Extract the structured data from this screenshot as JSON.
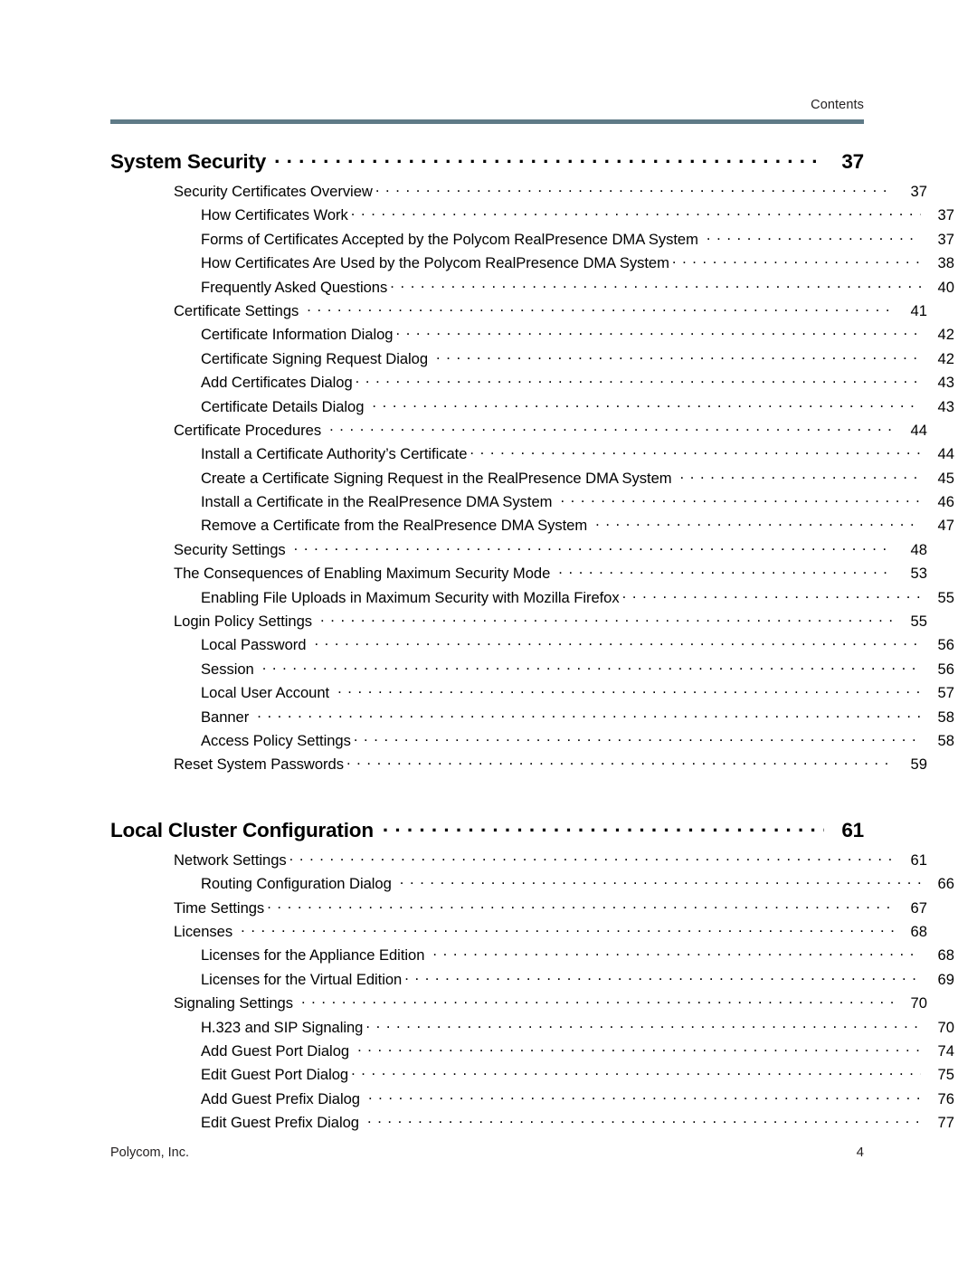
{
  "header": {
    "running_head": "Contents",
    "rule_color": "#5f7a87"
  },
  "footer": {
    "company": "Polycom, Inc.",
    "page_number": "4"
  },
  "toc": {
    "entries": [
      {
        "level": 0,
        "label": "System Security",
        "page": "37",
        "gap_before": false,
        "wide_leader_gap": true
      },
      {
        "level": 1,
        "label": "Security Certificates Overview",
        "page": "37",
        "gap_before": false,
        "wide_leader_gap": false
      },
      {
        "level": 2,
        "label": "How Certificates Work",
        "page": "37",
        "gap_before": false,
        "wide_leader_gap": false
      },
      {
        "level": 2,
        "label": "Forms of Certificates Accepted by the Polycom RealPresence DMA System",
        "page": "37",
        "gap_before": false,
        "wide_leader_gap": true
      },
      {
        "level": 2,
        "label": "How Certificates Are Used by the Polycom RealPresence DMA System",
        "page": "38",
        "gap_before": false,
        "wide_leader_gap": false
      },
      {
        "level": 2,
        "label": "Frequently Asked Questions",
        "page": "40",
        "gap_before": false,
        "wide_leader_gap": false
      },
      {
        "level": 1,
        "label": "Certificate Settings",
        "page": "41",
        "gap_before": false,
        "wide_leader_gap": true
      },
      {
        "level": 2,
        "label": "Certificate Information Dialog",
        "page": "42",
        "gap_before": false,
        "wide_leader_gap": false
      },
      {
        "level": 2,
        "label": "Certificate Signing Request Dialog",
        "page": "42",
        "gap_before": false,
        "wide_leader_gap": true
      },
      {
        "level": 2,
        "label": "Add Certificates Dialog",
        "page": "43",
        "gap_before": false,
        "wide_leader_gap": false
      },
      {
        "level": 2,
        "label": "Certificate Details Dialog",
        "page": "43",
        "gap_before": false,
        "wide_leader_gap": true
      },
      {
        "level": 1,
        "label": "Certificate Procedures",
        "page": "44",
        "gap_before": false,
        "wide_leader_gap": true
      },
      {
        "level": 2,
        "label": "Install a Certificate Authority’s Certificate",
        "page": "44",
        "gap_before": false,
        "wide_leader_gap": false
      },
      {
        "level": 2,
        "label": "Create a Certificate Signing Request in the RealPresence DMA System",
        "page": "45",
        "gap_before": false,
        "wide_leader_gap": true
      },
      {
        "level": 2,
        "label": "Install a Certificate in the RealPresence DMA System",
        "page": "46",
        "gap_before": false,
        "wide_leader_gap": true
      },
      {
        "level": 2,
        "label": "Remove a Certificate from the RealPresence DMA System",
        "page": "47",
        "gap_before": false,
        "wide_leader_gap": true
      },
      {
        "level": 1,
        "label": "Security Settings",
        "page": "48",
        "gap_before": false,
        "wide_leader_gap": true
      },
      {
        "level": 1,
        "label": "The Consequences of Enabling Maximum Security Mode",
        "page": "53",
        "gap_before": false,
        "wide_leader_gap": true
      },
      {
        "level": 2,
        "label": "Enabling File Uploads in Maximum Security with Mozilla Firefox",
        "page": "55",
        "gap_before": false,
        "wide_leader_gap": false
      },
      {
        "level": 1,
        "label": "Login Policy Settings",
        "page": "55",
        "gap_before": false,
        "wide_leader_gap": true
      },
      {
        "level": 2,
        "label": "Local Password",
        "page": "56",
        "gap_before": false,
        "wide_leader_gap": true
      },
      {
        "level": 2,
        "label": "Session",
        "page": "56",
        "gap_before": false,
        "wide_leader_gap": true
      },
      {
        "level": 2,
        "label": "Local User Account",
        "page": "57",
        "gap_before": false,
        "wide_leader_gap": true
      },
      {
        "level": 2,
        "label": "Banner",
        "page": "58",
        "gap_before": false,
        "wide_leader_gap": true
      },
      {
        "level": 2,
        "label": "Access Policy Settings",
        "page": "58",
        "gap_before": false,
        "wide_leader_gap": false
      },
      {
        "level": 1,
        "label": "Reset System Passwords",
        "page": "59",
        "gap_before": false,
        "wide_leader_gap": false
      },
      {
        "level": 0,
        "label": "Local Cluster Configuration",
        "page": "61",
        "gap_before": true,
        "wide_leader_gap": false
      },
      {
        "level": 1,
        "label": "Network Settings",
        "page": "61",
        "gap_before": false,
        "wide_leader_gap": false
      },
      {
        "level": 2,
        "label": "Routing Configuration Dialog",
        "page": "66",
        "gap_before": false,
        "wide_leader_gap": true
      },
      {
        "level": 1,
        "label": "Time Settings",
        "page": "67",
        "gap_before": false,
        "wide_leader_gap": false
      },
      {
        "level": 1,
        "label": "Licenses",
        "page": "68",
        "gap_before": false,
        "wide_leader_gap": true
      },
      {
        "level": 2,
        "label": "Licenses for the Appliance Edition",
        "page": "68",
        "gap_before": false,
        "wide_leader_gap": true
      },
      {
        "level": 2,
        "label": "Licenses for the Virtual Edition",
        "page": "69",
        "gap_before": false,
        "wide_leader_gap": false
      },
      {
        "level": 1,
        "label": "Signaling Settings",
        "page": "70",
        "gap_before": false,
        "wide_leader_gap": true
      },
      {
        "level": 2,
        "label": "H.323 and SIP Signaling",
        "page": "70",
        "gap_before": false,
        "wide_leader_gap": false
      },
      {
        "level": 2,
        "label": "Add Guest Port Dialog",
        "page": "74",
        "gap_before": false,
        "wide_leader_gap": true
      },
      {
        "level": 2,
        "label": "Edit Guest Port Dialog",
        "page": "75",
        "gap_before": false,
        "wide_leader_gap": false
      },
      {
        "level": 2,
        "label": "Add Guest Prefix Dialog",
        "page": "76",
        "gap_before": false,
        "wide_leader_gap": true
      },
      {
        "level": 2,
        "label": "Edit Guest Prefix Dialog",
        "page": "77",
        "gap_before": false,
        "wide_leader_gap": true
      }
    ]
  }
}
